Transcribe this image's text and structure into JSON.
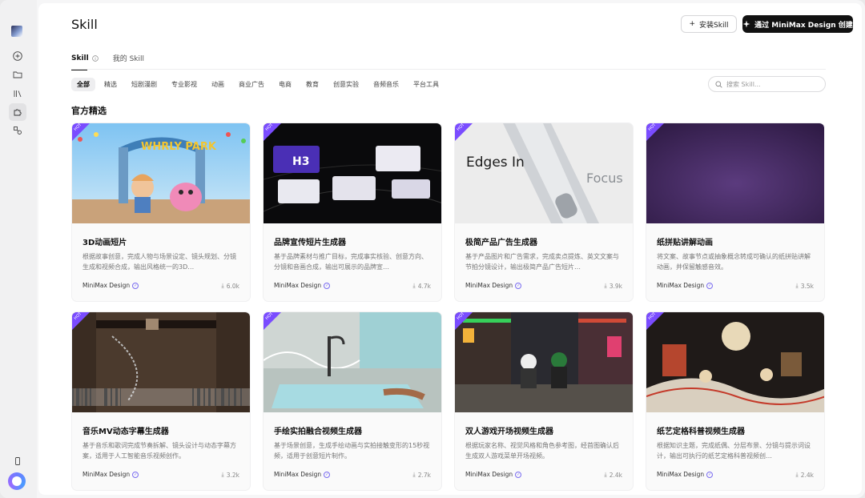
{
  "window": {
    "traffic_lights": [
      "close",
      "minimize",
      "zoom"
    ]
  },
  "sidebar": {
    "items": [
      {
        "icon": "new-icon"
      },
      {
        "icon": "folder-icon"
      },
      {
        "icon": "library-icon"
      },
      {
        "icon": "puzzle-icon",
        "active": true
      },
      {
        "icon": "nodes-icon"
      },
      {
        "icon": "phone-icon"
      }
    ]
  },
  "header": {
    "title": "Skill",
    "install_label": "安装Skill",
    "create_label": "通过 MiniMax Design 创建"
  },
  "tabs": [
    {
      "label": "Skill",
      "active": true
    },
    {
      "label": "我的 Skill",
      "active": false
    }
  ],
  "categories": [
    {
      "label": "全部",
      "active": true
    },
    {
      "label": "精选"
    },
    {
      "label": "短剧漫剧"
    },
    {
      "label": "专业影视"
    },
    {
      "label": "动画"
    },
    {
      "label": "商业广告"
    },
    {
      "label": "电商"
    },
    {
      "label": "教育"
    },
    {
      "label": "创意实验"
    },
    {
      "label": "音频音乐"
    },
    {
      "label": "平台工具"
    }
  ],
  "search": {
    "placeholder": "搜索 Skill..."
  },
  "section": {
    "title": "官方精选"
  },
  "badge_text": "HOT",
  "colors": {
    "accent": "#7a4cff",
    "primary_button": "#111111"
  },
  "cards": [
    {
      "title": "3D动画短片",
      "desc": "根据故事创意，完成人物与场景设定、镜头规划、分镜生成和视频合成，输出风格统一的3D…",
      "author": "MiniMax Design",
      "downloads": "6.0k",
      "thumb_text": "WHRLY PARK"
    },
    {
      "title": "品牌宣传短片生成器",
      "desc": "基于品牌素材与推广目标，完成事实核验、创意方向、分镜和音画合成，输出可展示的品牌宣…",
      "author": "MiniMax Design",
      "downloads": "4.7k",
      "thumb_text": "H3"
    },
    {
      "title": "极简产品广告生成器",
      "desc": "基于产品图片和广告需求，完成卖点提炼、英文文案与节拍分镜设计，输出极简产品广告短片…",
      "author": "MiniMax Design",
      "downloads": "3.9k",
      "thumb_text": "Edges In",
      "thumb_text2": "Focus"
    },
    {
      "title": "纸拼贴讲解动画",
      "desc": "将文案、故事节点或抽象概念转成可确认的纸拼贴讲解动画，并保留触感音效。",
      "author": "MiniMax Design",
      "downloads": "3.5k"
    },
    {
      "title": "音乐MV动态字幕生成器",
      "desc": "基于音乐和歌词完成节奏拆解、镜头设计与动态字幕方案，适用于人工智能音乐视频创作。",
      "author": "MiniMax Design",
      "downloads": "3.2k"
    },
    {
      "title": "手绘实拍融合视频生成器",
      "desc": "基于场景创意，生成手绘动画与实拍接触变形的15秒视频，适用于创意短片制作。",
      "author": "MiniMax Design",
      "downloads": "2.7k"
    },
    {
      "title": "双人游戏开场视频生成器",
      "desc": "根据玩家名称、视觉风格和角色参考图，经首图确认后生成双人游戏菜单开场视频。",
      "author": "MiniMax Design",
      "downloads": "2.4k"
    },
    {
      "title": "纸艺定格科普视频生成器",
      "desc": "根据知识主题，完成纸偶、分层布景、分镜与提示词设计，输出可执行的纸艺定格科普视频创…",
      "author": "MiniMax Design",
      "downloads": "2.4k"
    }
  ]
}
